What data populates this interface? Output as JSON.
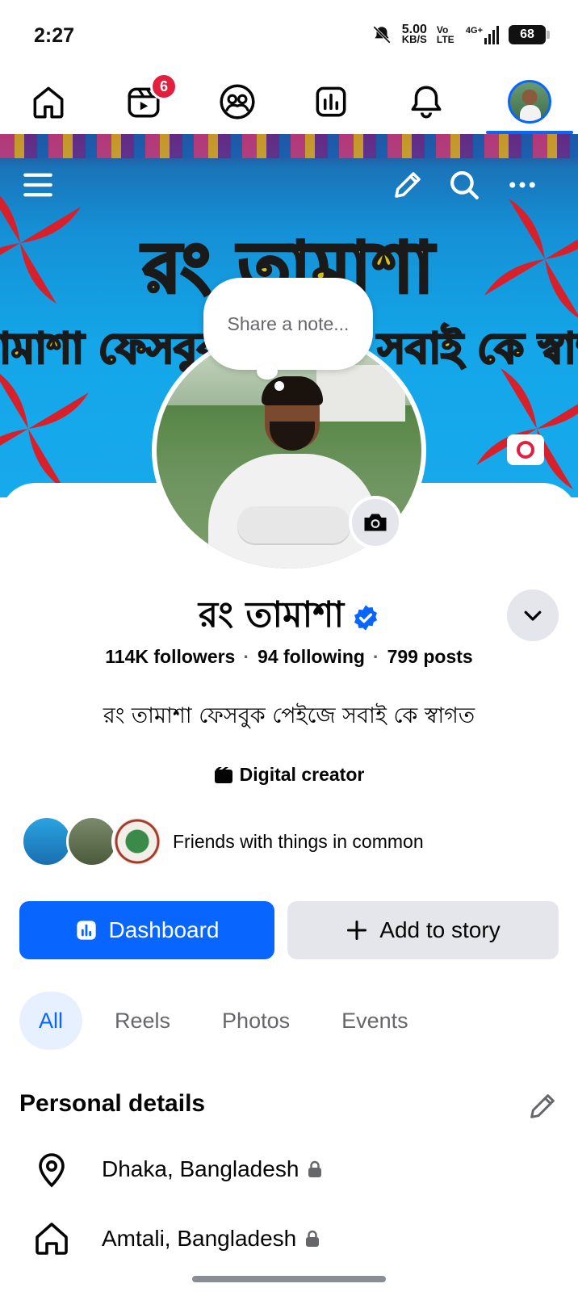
{
  "status_bar": {
    "time": "2:27",
    "net_speed": "5.00",
    "net_unit": "KB/S",
    "volte": "Vo LTE",
    "signal": "4G+",
    "battery": "68"
  },
  "nav": {
    "reels_badge": "6",
    "items": [
      "home-icon",
      "reels-icon",
      "friends-icon",
      "dashboard-icon",
      "notifications-icon",
      "profile-avatar"
    ]
  },
  "cover": {
    "title": "রং তামাশা",
    "subtitle": "তামাশা ফেসবুক পেইজে সবাই কে স্বাগত"
  },
  "note": {
    "placeholder": "Share a note..."
  },
  "profile": {
    "name": "রং তামাশা",
    "followers": "114K followers",
    "following": "94 following",
    "posts": "799 posts",
    "bio": "রং তামাশা ফেসবুক পেইজে সবাই কে স্বাগত",
    "category": "Digital creator",
    "friends_text": "Friends with things in common"
  },
  "actions": {
    "dashboard": "Dashboard",
    "add_story": "Add to story"
  },
  "tabs": [
    "All",
    "Reels",
    "Photos",
    "Events"
  ],
  "personal_details": {
    "title": "Personal details",
    "items": [
      {
        "icon": "location-pin-icon",
        "text": "Dhaka, Bangladesh"
      },
      {
        "icon": "home-icon",
        "text": "Amtali, Bangladesh"
      }
    ]
  },
  "colors": {
    "accent": "#0866ff",
    "badge": "#e41e3f",
    "secondary_button": "#e4e6eb"
  }
}
